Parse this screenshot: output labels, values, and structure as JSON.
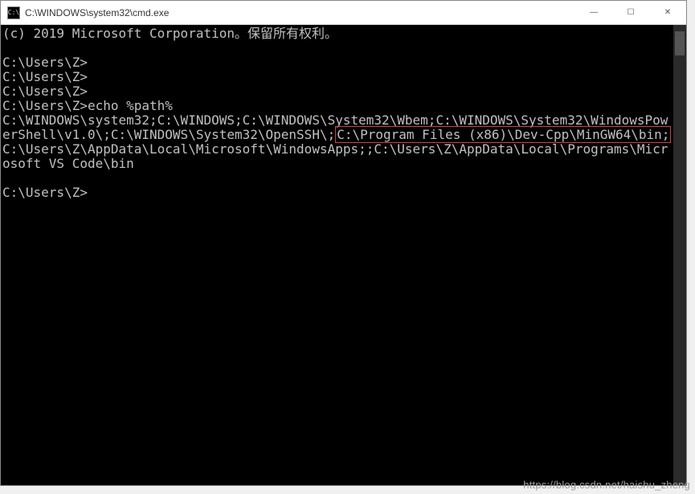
{
  "window": {
    "title": "C:\\WINDOWS\\system32\\cmd.exe",
    "icon_label": "C:\\"
  },
  "controls": {
    "minimize": "—",
    "maximize": "☐",
    "close": "✕"
  },
  "terminal": {
    "copyright": "(c) 2019 Microsoft Corporation。保留所有权利。",
    "prompt1": "C:\\Users\\Z>",
    "prompt2": "C:\\Users\\Z>",
    "prompt3": "C:\\Users\\Z>",
    "cmd_line_prompt": "C:\\Users\\Z>",
    "cmd_line_cmd": "echo %path%",
    "path_before": "C:\\WINDOWS\\system32;C:\\WINDOWS;C:\\WINDOWS\\System32\\Wbem;C:\\WINDOWS\\System32\\WindowsPowerShell\\v1.0\\;C:\\WINDOWS\\System32\\OpenSSH\\;",
    "path_highlight": "C:\\Program Files (x86)\\Dev-Cpp\\MinGW64\\bin;",
    "path_after": "C:\\Users\\Z\\AppData\\Local\\Microsoft\\WindowsApps;;C:\\Users\\Z\\AppData\\Local\\Programs\\Microsoft VS Code\\bin",
    "prompt_end": "C:\\Users\\Z>"
  },
  "watermark": "https://blog.csdn.net/haishu_zheng"
}
